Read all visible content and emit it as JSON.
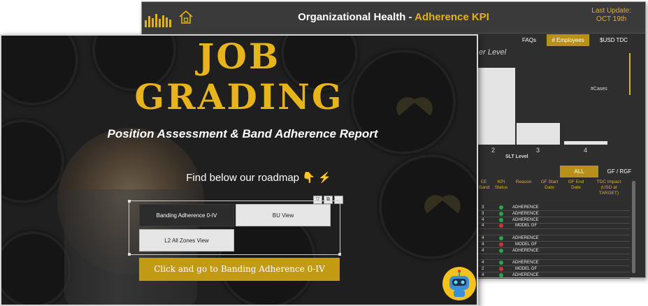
{
  "back_window": {
    "title_prefix": "Organizational Health -",
    "title_accent": "Adherence KPI",
    "last_update_label": "Last Update:",
    "last_update_date": "OCT 19th",
    "tabs": [
      "FAQs",
      "# Employees",
      "$USD TDC"
    ],
    "active_tab_index": 1,
    "chart_title": "er Level",
    "cases_label": "#Cases",
    "x_axis_label": "SLT Level",
    "filters": [
      "ALL",
      "GF / RGF"
    ],
    "table_headers": [
      "EE\nBand",
      "KPI\nStatus",
      "Reason",
      "GF Start\nDate",
      "GF End\nDate",
      "TDC Impact\n(USD at\nTARGET)"
    ],
    "table_rows": [
      {
        "band": "3",
        "status": "green",
        "reason": "ADHERENCE"
      },
      {
        "band": "3",
        "status": "green",
        "reason": "ADHERENCE"
      },
      {
        "band": "4",
        "status": "green",
        "reason": "ADHERENCE"
      },
      {
        "band": "4",
        "status": "red",
        "reason": "MODEL GF"
      },
      {
        "band": "",
        "status": "",
        "reason": ""
      },
      {
        "band": "4",
        "status": "green",
        "reason": "ADHERENCE"
      },
      {
        "band": "4",
        "status": "red",
        "reason": "MODEL GF"
      },
      {
        "band": "4",
        "status": "green",
        "reason": "ADHERENCE"
      },
      {
        "band": "",
        "status": "",
        "reason": ""
      },
      {
        "band": "4",
        "status": "green",
        "reason": "ADHERENCE"
      },
      {
        "band": "2",
        "status": "red",
        "reason": "MODEL GF"
      },
      {
        "band": "4",
        "status": "green",
        "reason": "ADHERENCE"
      }
    ]
  },
  "chart_data": {
    "type": "bar",
    "categories": [
      "2",
      "3",
      "4"
    ],
    "values": [
      100,
      28,
      5
    ],
    "xlabel": "SLT Level",
    "ylabel": "#Cases"
  },
  "front_window": {
    "title_line1": "JOB",
    "title_line2": "GRADING",
    "subtitle": "Position Assessment & Band Adherence Report",
    "roadmap_text": "Find below our roadmap 👇 ⚡",
    "nav_buttons": [
      {
        "label": "Banding Adherence 0-IV"
      },
      {
        "label": "BU View"
      },
      {
        "label": "L2 All Zones View"
      }
    ],
    "cta_label": "Click and go to Banding Adherence 0-IV",
    "colors": {
      "accent": "#e7b41c",
      "button": "#c39a14"
    }
  }
}
